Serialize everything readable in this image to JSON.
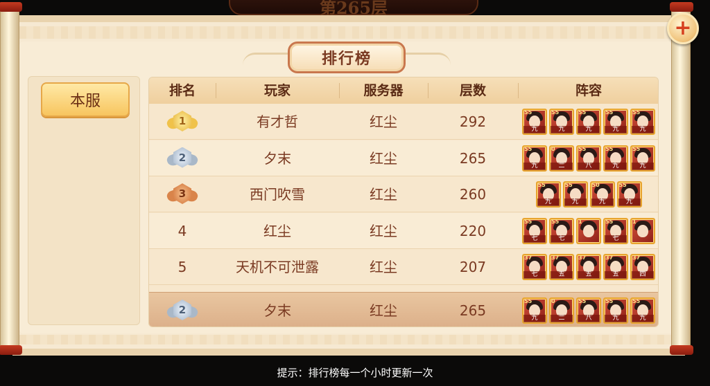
{
  "floor_banner": "第265层",
  "title": "排行榜",
  "plus_icon": "+",
  "tab": "本服",
  "columns": [
    "排名",
    "玩家",
    "服务器",
    "层数",
    "阵容"
  ],
  "rows": [
    {
      "rank": "1",
      "medal": "gold",
      "player": "有才哲",
      "server": "红尘",
      "floor": "292",
      "heroes": [
        {
          "lvl": "55",
          "star": "九"
        },
        {
          "lvl": "55",
          "star": "九"
        },
        {
          "lvl": "55",
          "star": "九"
        },
        {
          "lvl": "55",
          "star": "九"
        },
        {
          "lvl": "55",
          "star": "九"
        }
      ]
    },
    {
      "rank": "2",
      "medal": "silver",
      "player": "夕末",
      "server": "红尘",
      "floor": "265",
      "heroes": [
        {
          "lvl": "55",
          "star": "九"
        },
        {
          "lvl": "0",
          "star": "二"
        },
        {
          "lvl": "55",
          "star": "八"
        },
        {
          "lvl": "55",
          "star": "九"
        },
        {
          "lvl": "55",
          "star": "九"
        }
      ]
    },
    {
      "rank": "3",
      "medal": "bronze",
      "player": "西门吹雪",
      "server": "红尘",
      "floor": "260",
      "heroes": [
        {
          "lvl": "55",
          "star": "九"
        },
        {
          "lvl": "55",
          "star": "九"
        },
        {
          "lvl": "50",
          "star": "九"
        },
        {
          "lvl": "55",
          "star": "九"
        }
      ]
    },
    {
      "rank": "4",
      "medal": "",
      "player": "红尘",
      "server": "红尘",
      "floor": "220",
      "heroes": [
        {
          "lvl": "55",
          "star": "七"
        },
        {
          "lvl": "55",
          "star": "七"
        },
        {
          "lvl": "1",
          "star": ""
        },
        {
          "lvl": "55",
          "star": "七"
        },
        {
          "lvl": "1",
          "star": ""
        }
      ]
    },
    {
      "rank": "5",
      "medal": "",
      "player": "天机不可泄露",
      "server": "红尘",
      "floor": "207",
      "heroes": [
        {
          "lvl": "37",
          "star": "七"
        },
        {
          "lvl": "37",
          "star": "五"
        },
        {
          "lvl": "37",
          "star": "五"
        },
        {
          "lvl": "37",
          "star": "五"
        },
        {
          "lvl": "37",
          "star": "四"
        }
      ]
    }
  ],
  "self_row": {
    "rank": "2",
    "medal": "silver",
    "player": "夕末",
    "server": "红尘",
    "floor": "265",
    "heroes": [
      {
        "lvl": "55",
        "star": "九"
      },
      {
        "lvl": "0",
        "star": "二"
      },
      {
        "lvl": "55",
        "star": "八"
      },
      {
        "lvl": "55",
        "star": "九"
      },
      {
        "lvl": "55",
        "star": "九"
      }
    ]
  },
  "tip": "提示：排行榜每一个小时更新一次"
}
